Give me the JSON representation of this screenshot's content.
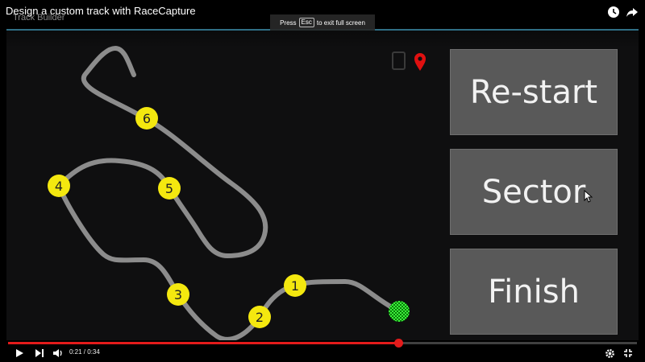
{
  "video": {
    "title": "Design a custom track with RaceCapture",
    "current_time": "0:21",
    "duration": "0:34",
    "time_separator": " / ",
    "progress": 0.62
  },
  "app": {
    "title": "Track Builder"
  },
  "fullscreen_notice": {
    "before": "Press",
    "key": "Esc",
    "after": "to exit full screen"
  },
  "buttons": {
    "restart": "Re-start",
    "sector": "Sector",
    "finish": "Finish"
  },
  "track": {
    "sectors": [
      "1",
      "2",
      "3",
      "4",
      "5",
      "6"
    ],
    "marker_color": "#f4e80f",
    "path_color": "#8c8c8c",
    "start_finish_color": "#27d327",
    "gps_pin_color": "#e01010"
  },
  "icons": {
    "top_right": [
      "clock-icon",
      "share-icon"
    ],
    "status": [
      "tablet-icon",
      "location-pin-icon"
    ],
    "controls_left": [
      "play-icon",
      "next-icon",
      "volume-icon"
    ],
    "controls_right": [
      "settings-icon",
      "exit-fullscreen-icon"
    ]
  },
  "colors": {
    "progress": "#e31b1b",
    "accent_line": "#2f6f85",
    "button_bg": "#595959"
  }
}
